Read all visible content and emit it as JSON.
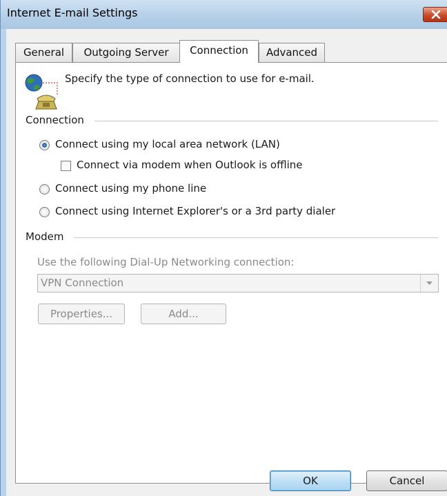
{
  "window": {
    "title": "Internet E-mail Settings",
    "close_icon": "close-icon"
  },
  "tabs": [
    {
      "label": "General",
      "active": false
    },
    {
      "label": "Outgoing Server",
      "active": false
    },
    {
      "label": "Connection",
      "active": true
    },
    {
      "label": "Advanced",
      "active": false
    }
  ],
  "intro": {
    "text": "Specify the type of connection to use for e-mail.",
    "icon": "network-phone-icon"
  },
  "connection": {
    "label": "Connection",
    "options": [
      {
        "label": "Connect using my local area network (LAN)",
        "checked": true
      },
      {
        "label": "Connect using my phone line",
        "checked": false
      },
      {
        "label": "Connect using Internet Explorer's or a 3rd party dialer",
        "checked": false
      }
    ],
    "modem_offline": {
      "label": "Connect via modem when Outlook is offline",
      "checked": false
    }
  },
  "modem": {
    "label": "Modem",
    "dialup_label": "Use the following Dial-Up Networking connection:",
    "dialup_value": "VPN Connection",
    "properties_label": "Properties...",
    "add_label": "Add..."
  },
  "footer": {
    "ok_label": "OK",
    "cancel_label": "Cancel"
  },
  "colors": {
    "titlebar": "#b6d0e8",
    "close": "#c94b2b",
    "default_button": "#bfe0f6"
  }
}
